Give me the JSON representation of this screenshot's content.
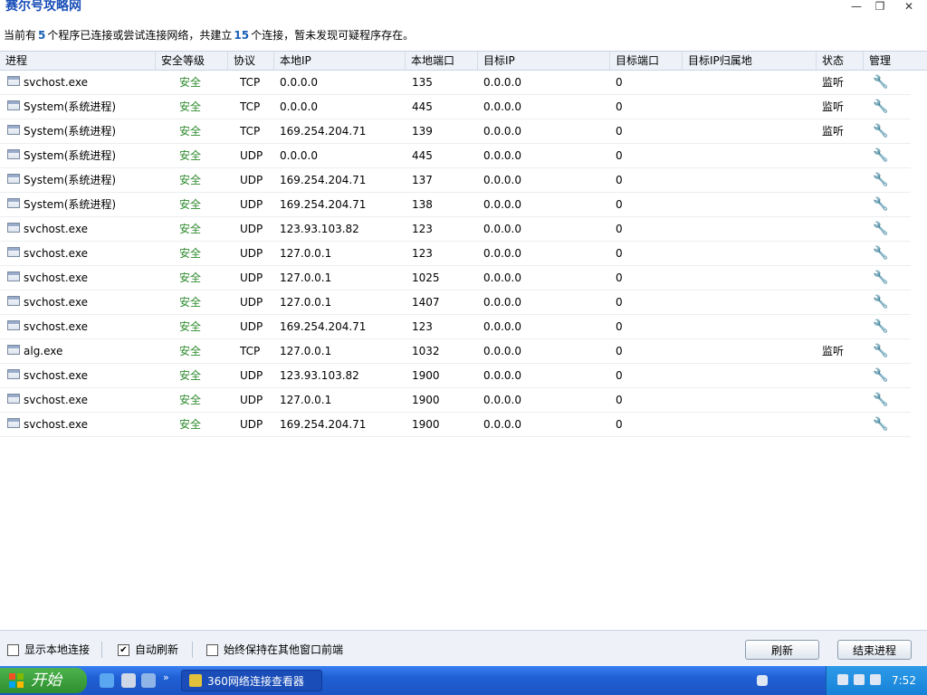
{
  "window": {
    "title": "赛尔号攻略网",
    "controls": {
      "minimize": "—",
      "restore": "❐",
      "close": "✕"
    }
  },
  "summary": {
    "prefix": "当前有",
    "program_count": "5",
    "middle": "个程序已连接或尝试连接网络，共建立",
    "connection_count": "15",
    "suffix": "个连接，暂未发现可疑程序存在。"
  },
  "columns": [
    "进程",
    "安全等级",
    "协议",
    "本地IP",
    "本地端口",
    "目标IP",
    "目标端口",
    "目标IP归属地",
    "状态",
    "管理"
  ],
  "rows": [
    {
      "process": "svchost.exe",
      "safety": "安全",
      "protocol": "TCP",
      "local_ip": "0.0.0.0",
      "local_port": "135",
      "remote_ip": "0.0.0.0",
      "remote_port": "0",
      "location": "",
      "status": "监听"
    },
    {
      "process": "System(系统进程)",
      "safety": "安全",
      "protocol": "TCP",
      "local_ip": "0.0.0.0",
      "local_port": "445",
      "remote_ip": "0.0.0.0",
      "remote_port": "0",
      "location": "",
      "status": "监听"
    },
    {
      "process": "System(系统进程)",
      "safety": "安全",
      "protocol": "TCP",
      "local_ip": "169.254.204.71",
      "local_port": "139",
      "remote_ip": "0.0.0.0",
      "remote_port": "0",
      "location": "",
      "status": "监听"
    },
    {
      "process": "System(系统进程)",
      "safety": "安全",
      "protocol": "UDP",
      "local_ip": "0.0.0.0",
      "local_port": "445",
      "remote_ip": "0.0.0.0",
      "remote_port": "0",
      "location": "",
      "status": ""
    },
    {
      "process": "System(系统进程)",
      "safety": "安全",
      "protocol": "UDP",
      "local_ip": "169.254.204.71",
      "local_port": "137",
      "remote_ip": "0.0.0.0",
      "remote_port": "0",
      "location": "",
      "status": ""
    },
    {
      "process": "System(系统进程)",
      "safety": "安全",
      "protocol": "UDP",
      "local_ip": "169.254.204.71",
      "local_port": "138",
      "remote_ip": "0.0.0.0",
      "remote_port": "0",
      "location": "",
      "status": ""
    },
    {
      "process": "svchost.exe",
      "safety": "安全",
      "protocol": "UDP",
      "local_ip": "123.93.103.82",
      "local_port": "123",
      "remote_ip": "0.0.0.0",
      "remote_port": "0",
      "location": "",
      "status": ""
    },
    {
      "process": "svchost.exe",
      "safety": "安全",
      "protocol": "UDP",
      "local_ip": "127.0.0.1",
      "local_port": "123",
      "remote_ip": "0.0.0.0",
      "remote_port": "0",
      "location": "",
      "status": ""
    },
    {
      "process": "svchost.exe",
      "safety": "安全",
      "protocol": "UDP",
      "local_ip": "127.0.0.1",
      "local_port": "1025",
      "remote_ip": "0.0.0.0",
      "remote_port": "0",
      "location": "",
      "status": ""
    },
    {
      "process": "svchost.exe",
      "safety": "安全",
      "protocol": "UDP",
      "local_ip": "127.0.0.1",
      "local_port": "1407",
      "remote_ip": "0.0.0.0",
      "remote_port": "0",
      "location": "",
      "status": ""
    },
    {
      "process": "svchost.exe",
      "safety": "安全",
      "protocol": "UDP",
      "local_ip": "169.254.204.71",
      "local_port": "123",
      "remote_ip": "0.0.0.0",
      "remote_port": "0",
      "location": "",
      "status": ""
    },
    {
      "process": "alg.exe",
      "safety": "安全",
      "protocol": "TCP",
      "local_ip": "127.0.0.1",
      "local_port": "1032",
      "remote_ip": "0.0.0.0",
      "remote_port": "0",
      "location": "",
      "status": "监听"
    },
    {
      "process": "svchost.exe",
      "safety": "安全",
      "protocol": "UDP",
      "local_ip": "123.93.103.82",
      "local_port": "1900",
      "remote_ip": "0.0.0.0",
      "remote_port": "0",
      "location": "",
      "status": ""
    },
    {
      "process": "svchost.exe",
      "safety": "安全",
      "protocol": "UDP",
      "local_ip": "127.0.0.1",
      "local_port": "1900",
      "remote_ip": "0.0.0.0",
      "remote_port": "0",
      "location": "",
      "status": ""
    },
    {
      "process": "svchost.exe",
      "safety": "安全",
      "protocol": "UDP",
      "local_ip": "169.254.204.71",
      "local_port": "1900",
      "remote_ip": "0.0.0.0",
      "remote_port": "0",
      "location": "",
      "status": ""
    }
  ],
  "footer": {
    "show_local": {
      "label": "显示本地连接",
      "checked": false
    },
    "auto_refresh": {
      "label": "自动刷新",
      "checked": true
    },
    "always_on_top": {
      "label": "始终保持在其他窗口前端",
      "checked": false
    },
    "refresh_button": "刷新",
    "end_process_button": "结束进程"
  },
  "taskbar": {
    "start_label": "开始",
    "task_label": "360网络连接查看器",
    "clock": "7:52"
  },
  "colors": {
    "safe": "#2e8b2e",
    "accent": "#1a5fb4",
    "taskbar": "#1f5fd4",
    "start": "#3a9e3a"
  },
  "icons": {
    "manage": "wrench-icon",
    "process": "window-icon"
  }
}
